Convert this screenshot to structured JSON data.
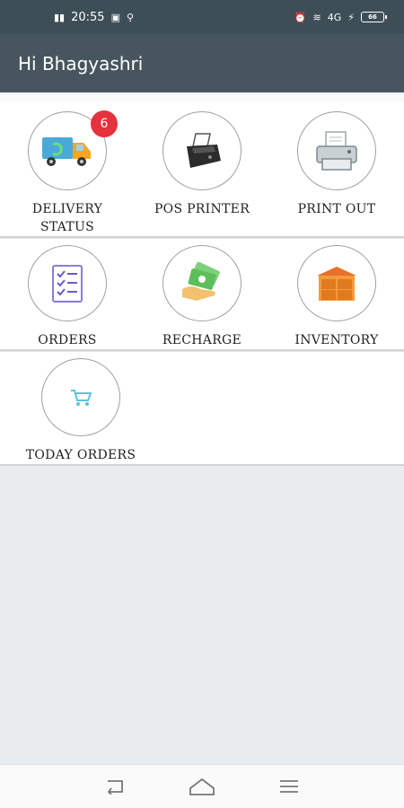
{
  "status_bar": {
    "time": "20:55",
    "signal": "4G",
    "battery": "66"
  },
  "app_bar": {
    "greeting": "Hi Bhagyashri"
  },
  "tiles": [
    {
      "label": "DELIVERY\nSTATUS",
      "icon": "delivery-truck-icon",
      "badge": "6"
    },
    {
      "label": "POS PRINTER",
      "icon": "pos-printer-icon"
    },
    {
      "label": "PRINT OUT",
      "icon": "printer-icon"
    },
    {
      "label": "ORDERS",
      "icon": "checklist-icon"
    },
    {
      "label": "RECHARGE",
      "icon": "money-hand-icon"
    },
    {
      "label": "INVENTORY",
      "icon": "warehouse-boxes-icon"
    },
    {
      "label": "TODAY ORDERS",
      "icon": "shopping-cart-icon"
    }
  ],
  "nav_bar": {
    "items": [
      "back-icon",
      "home-icon",
      "menu-icon"
    ]
  },
  "colors": {
    "app_bar": "#47565e",
    "status_bar": "#3e4e57",
    "badge": "#e5323e",
    "background": "#e9ecef"
  }
}
